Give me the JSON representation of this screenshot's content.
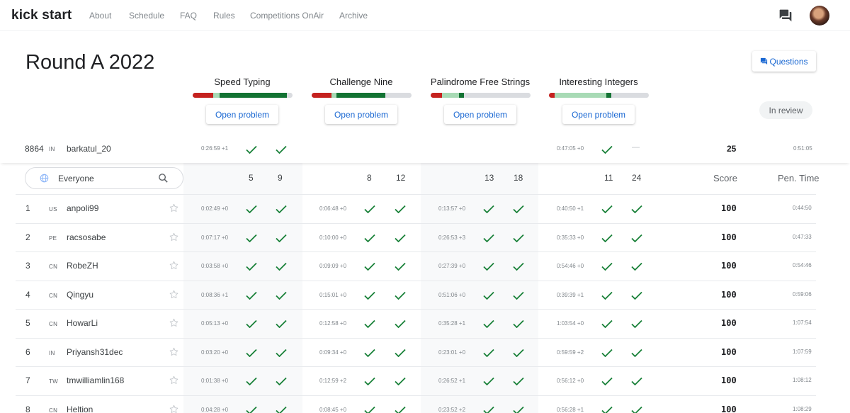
{
  "nav": {
    "brand": "kick start",
    "links": [
      "About",
      "Schedule",
      "FAQ",
      "Rules",
      "Competitions OnAir",
      "Archive"
    ]
  },
  "contest": {
    "title": "Round A 2022",
    "questions_label": "Questions",
    "status": "In review",
    "open_label": "Open problem"
  },
  "problems": [
    {
      "name": "Speed Typing",
      "bar": [
        {
          "color": "#c5221f",
          "pct": 21
        },
        {
          "color": "#a8dab5",
          "pct": 6
        },
        {
          "color": "#137333",
          "pct": 68
        },
        {
          "color": "#dadce0",
          "pct": 5
        }
      ]
    },
    {
      "name": "Challenge Nine",
      "bar": [
        {
          "color": "#c5221f",
          "pct": 20
        },
        {
          "color": "#a8dab5",
          "pct": 5
        },
        {
          "color": "#137333",
          "pct": 49
        },
        {
          "color": "#dadce0",
          "pct": 26
        }
      ]
    },
    {
      "name": "Palindrome Free Strings",
      "bar": [
        {
          "color": "#c5221f",
          "pct": 12
        },
        {
          "color": "#a8dab5",
          "pct": 17
        },
        {
          "color": "#137333",
          "pct": 5
        },
        {
          "color": "#dadce0",
          "pct": 66
        }
      ]
    },
    {
      "name": "Interesting Integers",
      "bar": [
        {
          "color": "#c5221f",
          "pct": 6
        },
        {
          "color": "#a8dab5",
          "pct": 52
        },
        {
          "color": "#137333",
          "pct": 5
        },
        {
          "color": "#dadce0",
          "pct": 37
        }
      ]
    }
  ],
  "my_row": {
    "rank": "8864",
    "country": "IN",
    "name": "barkatul_20",
    "p1_time": "0:26:59 +1",
    "p4_time": "0:47:05 +0",
    "p4_dash": "—",
    "score": "25",
    "pen": "0:51:05"
  },
  "filter": {
    "label": "Everyone"
  },
  "columns": {
    "points": [
      "5",
      "9",
      "8",
      "12",
      "13",
      "18",
      "11",
      "24"
    ],
    "score": "Score",
    "pen": "Pen. Time"
  },
  "rows": [
    {
      "rank": "1",
      "country": "US",
      "name": "anpoli99",
      "times": [
        "0:02:49 +0",
        "0:06:48 +0",
        "0:13:57 +0",
        "0:40:50 +1"
      ],
      "score": "100",
      "pen": "0:44:50"
    },
    {
      "rank": "2",
      "country": "PE",
      "name": "racsosabe",
      "times": [
        "0:07:17 +0",
        "0:10:00 +0",
        "0:26:53 +3",
        "0:35:33 +0"
      ],
      "score": "100",
      "pen": "0:47:33"
    },
    {
      "rank": "3",
      "country": "CN",
      "name": "RobeZH",
      "times": [
        "0:03:58 +0",
        "0:09:09 +0",
        "0:27:39 +0",
        "0:54:46 +0"
      ],
      "score": "100",
      "pen": "0:54:46"
    },
    {
      "rank": "4",
      "country": "CN",
      "name": "Qingyu",
      "times": [
        "0:08:36 +1",
        "0:15:01 +0",
        "0:51:06 +0",
        "0:39:39 +1"
      ],
      "score": "100",
      "pen": "0:59:06"
    },
    {
      "rank": "5",
      "country": "CN",
      "name": "HowarLi",
      "times": [
        "0:05:13 +0",
        "0:12:58 +0",
        "0:35:28 +1",
        "1:03:54 +0"
      ],
      "score": "100",
      "pen": "1:07:54"
    },
    {
      "rank": "6",
      "country": "IN",
      "name": "Priyansh31dec",
      "times": [
        "0:03:20 +0",
        "0:09:34 +0",
        "0:23:01 +0",
        "0:59:59 +2"
      ],
      "score": "100",
      "pen": "1:07:59"
    },
    {
      "rank": "7",
      "country": "TW",
      "name": "tmwilliamlin168",
      "times": [
        "0:01:38 +0",
        "0:12:59 +2",
        "0:26:52 +1",
        "0:56:12 +0"
      ],
      "score": "100",
      "pen": "1:08:12"
    },
    {
      "rank": "8",
      "country": "CN",
      "name": "Heltion",
      "times": [
        "0:04:28 +0",
        "0:08:45 +0",
        "0:23:52 +2",
        "0:56:28 +1"
      ],
      "score": "100",
      "pen": "1:08:29"
    }
  ],
  "colors": {
    "check": "#188038",
    "link": "#1967d2",
    "shade": "#f8f9fa"
  }
}
